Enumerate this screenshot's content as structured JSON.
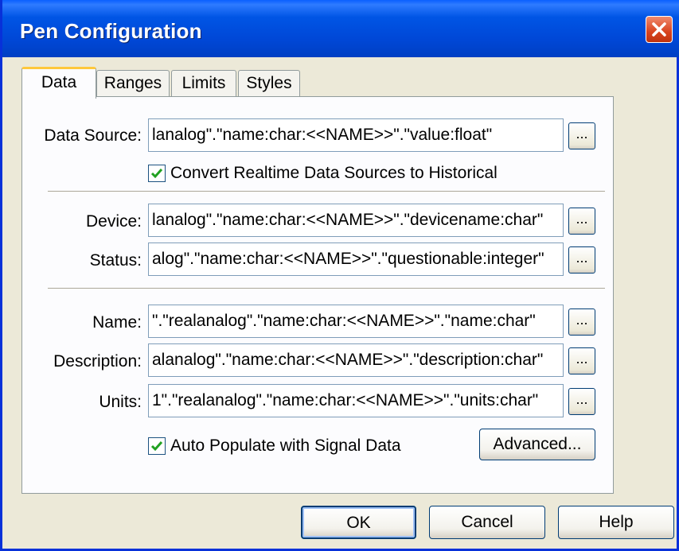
{
  "window": {
    "title": "Pen Configuration"
  },
  "tabs": [
    {
      "label": "Data"
    },
    {
      "label": "Ranges"
    },
    {
      "label": "Limits"
    },
    {
      "label": "Styles"
    }
  ],
  "data_source": {
    "label": "Data Source:",
    "value": "lanalog\".\"name:char:<<NAME>>\".\"value:float\""
  },
  "convert_checkbox": {
    "label": "Convert Realtime Data Sources to Historical",
    "checked": true
  },
  "device": {
    "label": "Device:",
    "value": "lanalog\".\"name:char:<<NAME>>\".\"devicename:char\""
  },
  "status": {
    "label": "Status:",
    "value": "alog\".\"name:char:<<NAME>>\".\"questionable:integer\""
  },
  "name": {
    "label": "Name:",
    "value": "\".\"realanalog\".\"name:char:<<NAME>>\".\"name:char\""
  },
  "description": {
    "label": "Description:",
    "value": "alanalog\".\"name:char:<<NAME>>\".\"description:char\""
  },
  "units": {
    "label": "Units:",
    "value": "1\".\"realanalog\".\"name:char:<<NAME>>\".\"units:char\""
  },
  "browse_label": "...",
  "auto_populate_checkbox": {
    "label": "Auto Populate with Signal Data",
    "checked": true
  },
  "advanced_button": "Advanced...",
  "footer": {
    "ok": "OK",
    "cancel": "Cancel",
    "help": "Help"
  },
  "colors": {
    "titlebar": "#0055e5",
    "face": "#ece9d8",
    "check": "#21a121",
    "close": "#d8431e"
  }
}
